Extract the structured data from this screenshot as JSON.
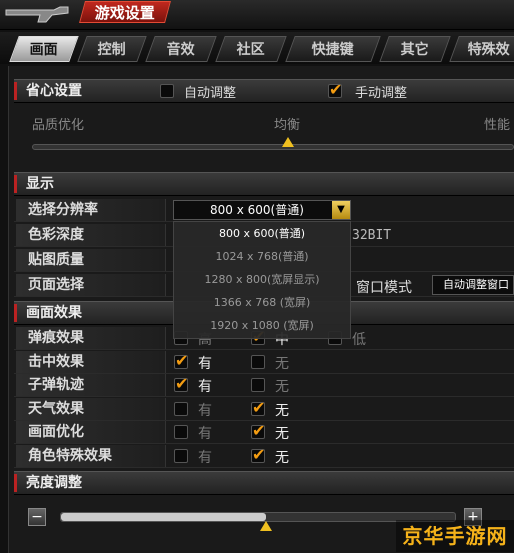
{
  "title": "游戏设置",
  "tabs": [
    "画面",
    "控制",
    "音效",
    "社区",
    "快捷键",
    "其它",
    "特殊效"
  ],
  "active_tab": "画面",
  "save_mode": {
    "label": "省心设置",
    "auto": "自动调整",
    "manual": "手动调整",
    "auto_checked": false,
    "manual_checked": true
  },
  "quality": {
    "label": "品质优化",
    "mid": "均衡",
    "right": "性能",
    "level": 0.5
  },
  "display": {
    "header": "显示",
    "resolution_label": "选择分辨率",
    "resolution_value": "800 x 600(普通)",
    "color_depth_label": "色彩深度",
    "color_depth_value": "32BIT",
    "texture_label": "贴图质量",
    "page_label": "页面选择",
    "window_mode_label": "窗口模式",
    "window_mode_value": "自动调整窗口"
  },
  "resolution_options": [
    "800 x 600(普通)",
    "1024 x 768(普通)",
    "1280 x 800(宽屏显示)",
    "1366 x 768 (宽屏)",
    "1920 x 1080 (宽屏)"
  ],
  "effects": {
    "header": "画面效果",
    "rows": [
      {
        "name": "弹痕效果",
        "opts": [
          {
            "t": "高",
            "c": false
          },
          {
            "t": "中",
            "c": true
          },
          {
            "t": "低",
            "c": false
          }
        ]
      },
      {
        "name": "击中效果",
        "opts": [
          {
            "t": "有",
            "c": true
          },
          {
            "t": "无",
            "c": false
          }
        ]
      },
      {
        "name": "子弹轨迹",
        "opts": [
          {
            "t": "有",
            "c": true
          },
          {
            "t": "无",
            "c": false
          }
        ]
      },
      {
        "name": "天气效果",
        "opts": [
          {
            "t": "有",
            "c": false
          },
          {
            "t": "无",
            "c": true
          }
        ]
      },
      {
        "name": "画面优化",
        "opts": [
          {
            "t": "有",
            "c": false
          },
          {
            "t": "无",
            "c": true
          }
        ]
      },
      {
        "name": "角色特殊效果",
        "opts": [
          {
            "t": "有",
            "c": false
          },
          {
            "t": "无",
            "c": true
          }
        ]
      }
    ]
  },
  "brightness": {
    "header": "亮度调整",
    "minus": "−",
    "plus": "+",
    "level": 0.52
  },
  "watermark": "京华手游网"
}
